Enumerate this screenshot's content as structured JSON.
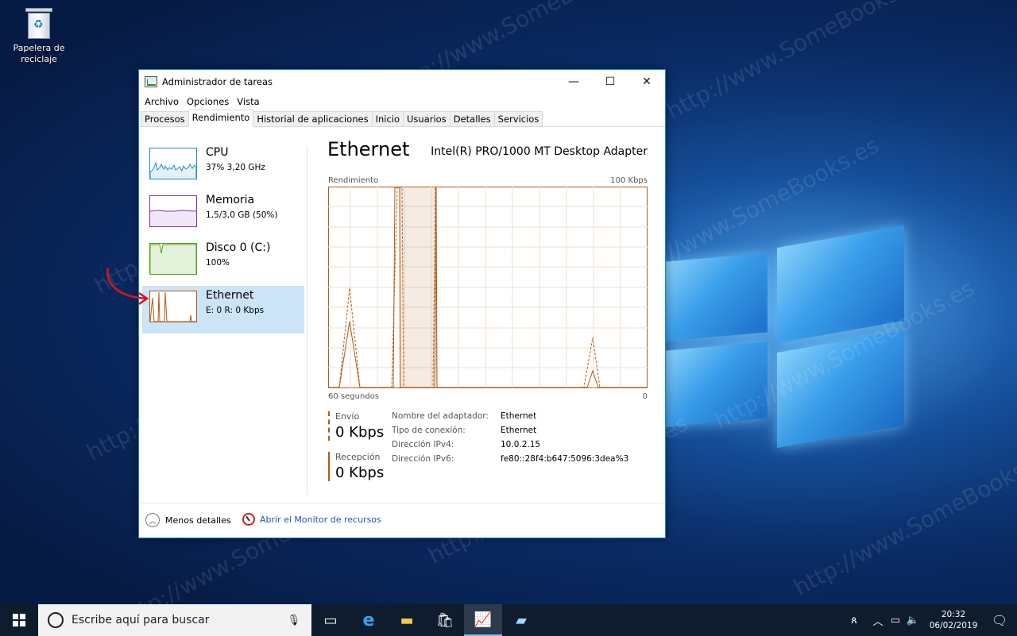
{
  "desktop": {
    "recycle_bin_label_1": "Papelera de",
    "recycle_bin_label_2": "reciclaje",
    "watermark": "http://www.SomeBooks.es"
  },
  "window": {
    "title": "Administrador de tareas",
    "controls": {
      "minimize": "—",
      "maximize": "☐",
      "close": "✕"
    },
    "menu": [
      "Archivo",
      "Opciones",
      "Vista"
    ],
    "tabs": [
      "Procesos",
      "Rendimiento",
      "Historial de aplicaciones",
      "Inicio",
      "Usuarios",
      "Detalles",
      "Servicios"
    ],
    "active_tab": "Rendimiento"
  },
  "sidebar": {
    "items": [
      {
        "name": "CPU",
        "sub": "37% 3,20 GHz",
        "color": "#1e8ec4"
      },
      {
        "name": "Memoria",
        "sub": "1,5/3,0 GB (50%)",
        "color": "#8b2fb4"
      },
      {
        "name": "Disco 0 (C:)",
        "sub": "100%",
        "color": "#4da60c"
      },
      {
        "name": "Ethernet",
        "sub": "E: 0 R: 0 Kbps",
        "color": "#b05b16",
        "selected": true
      }
    ]
  },
  "main": {
    "heading": "Ethernet",
    "adapter": "Intel(R) PRO/1000 MT Desktop Adapter",
    "graph_label": "Rendimiento",
    "graph_max": "100 Kbps",
    "time_left": "60 segundos",
    "time_right": "0",
    "send_label": "Envío",
    "send_value": "0 Kbps",
    "recv_label": "Recepción",
    "recv_value": "0 Kbps",
    "properties": [
      {
        "key": "Nombre del adaptador:",
        "value": "Ethernet"
      },
      {
        "key": "Tipo de conexión:",
        "value": "Ethernet"
      },
      {
        "key": "Dirección IPv4:",
        "value": "10.0.2.15"
      },
      {
        "key": "Dirección IPv6:",
        "value": "fe80::28f4:b647:5096:3dea%3"
      }
    ],
    "accent": "#b05b16"
  },
  "footer": {
    "less_details": "Menos detalles",
    "open_monitor": "Abrir el Monitor de recursos"
  },
  "taskbar": {
    "search_placeholder": "Escribe aquí para buscar",
    "time": "20:32",
    "date": "06/02/2019"
  }
}
